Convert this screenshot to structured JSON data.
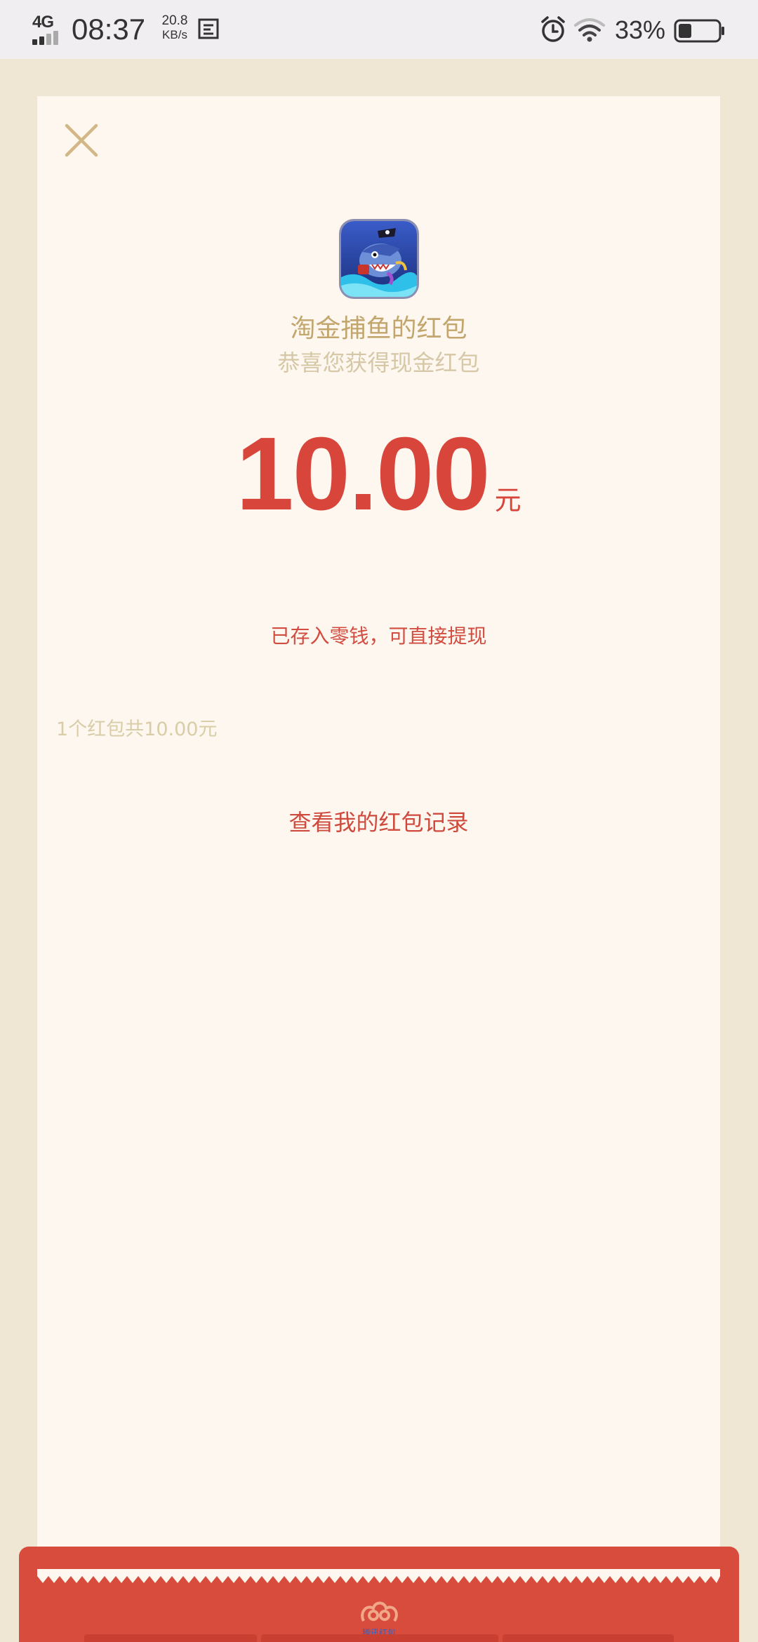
{
  "status_bar": {
    "network": "4G",
    "time": "08:37",
    "speed_value": "20.8",
    "speed_unit": "KB/s",
    "battery_percent": "33%",
    "battery_level": 0.33,
    "icons": [
      "signal-icon",
      "screenshot-icon",
      "alarm-icon",
      "wifi-icon",
      "battery-icon"
    ]
  },
  "red_packet": {
    "sender_title": "淘金捕鱼的红包",
    "greeting": "恭喜您获得现金红包",
    "amount": "10.00",
    "currency_unit": "元",
    "stored_note": "已存入零钱，可直接提现",
    "summary": "1个红包共10.00元",
    "record_link": "查看我的红包记录",
    "app_icon": "shark-game-app-icon",
    "close_icon": "close-icon"
  },
  "envelope_footer": {
    "caption": "腾讯红包",
    "emblem": "cloud-emblem-icon"
  },
  "colors": {
    "page_background": "#efe6d4",
    "card_background": "#fdf7ef",
    "amount_red": "#d8453b",
    "gold_text": "#c2a66e",
    "envelope_red": "#d84c3e"
  }
}
